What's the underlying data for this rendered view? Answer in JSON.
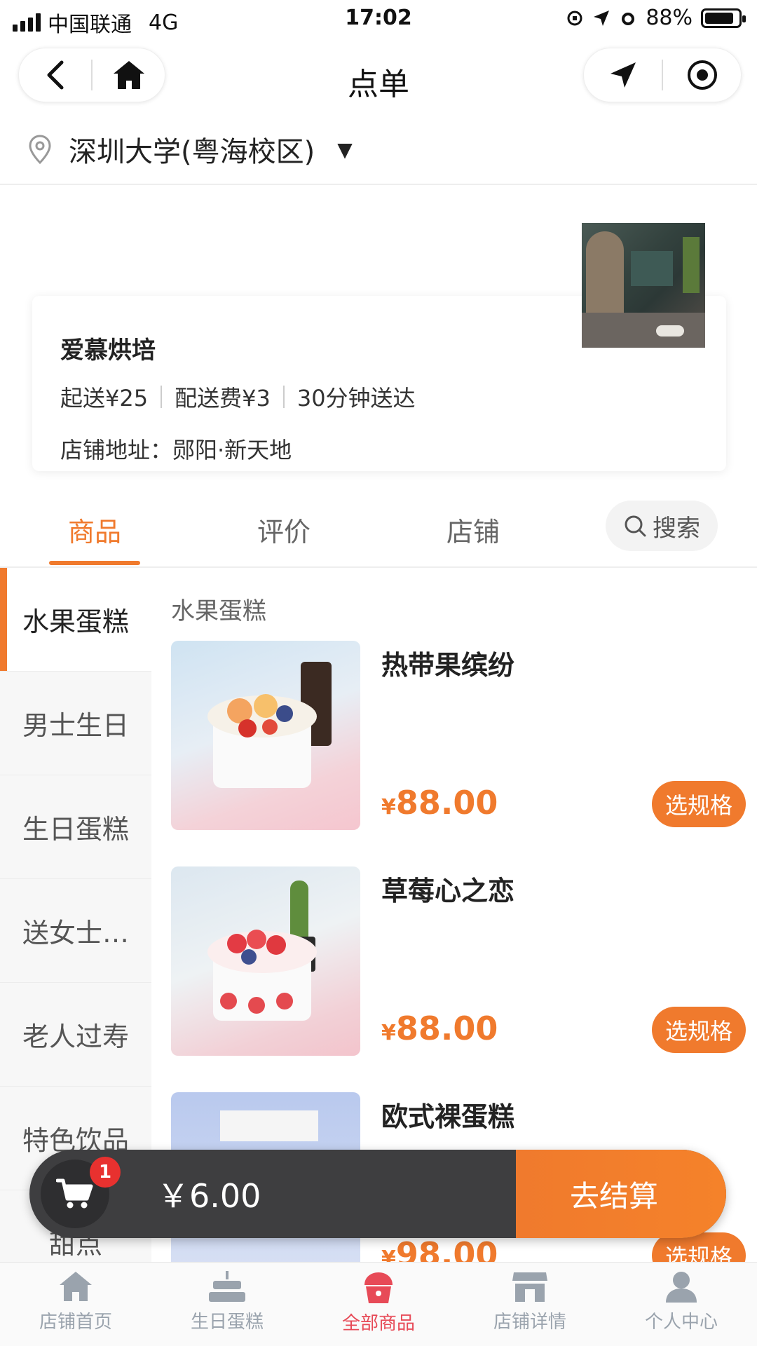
{
  "status_bar": {
    "carrier": "中国联通",
    "network": "4G",
    "time": "17:02",
    "battery_text": "88%",
    "battery_level": 0.88
  },
  "nav": {
    "title": "点单",
    "back_icon": "back-chevron-icon",
    "home_icon": "home-icon",
    "location_arrow_icon": "location-arrow-icon",
    "record_icon": "target-icon"
  },
  "location": {
    "name": "深圳大学(粤海校区)",
    "caret": "▼"
  },
  "store": {
    "name": "爱慕烘培",
    "min_order": "起送¥25",
    "delivery_fee": "配送费¥3",
    "delivery_time": "30分钟送达",
    "address": "店铺地址：郧阳·新天地"
  },
  "tabs": {
    "items": [
      {
        "label": "商品",
        "active": true
      },
      {
        "label": "评价",
        "active": false
      },
      {
        "label": "店铺",
        "active": false
      }
    ],
    "search_label": "搜索"
  },
  "sidebar": {
    "items": [
      {
        "label": "水果蛋糕",
        "active": true
      },
      {
        "label": "男士生日",
        "active": false
      },
      {
        "label": "生日蛋糕",
        "active": false
      },
      {
        "label": "送女士…",
        "active": false
      },
      {
        "label": "老人过寿",
        "active": false
      },
      {
        "label": "特色饮品",
        "active": false
      },
      {
        "label": "甜点",
        "active": false
      }
    ]
  },
  "products": {
    "category_title": "水果蛋糕",
    "items": [
      {
        "name": "热带果缤纷",
        "currency": "¥",
        "price": "88.00",
        "button": "选规格"
      },
      {
        "name": "草莓心之恋",
        "currency": "¥",
        "price": "88.00",
        "button": "选规格"
      },
      {
        "name": "欧式裸蛋糕",
        "currency": "¥",
        "price": "98.00",
        "button": "选规格"
      }
    ]
  },
  "cart": {
    "badge_count": "1",
    "total": "￥6.00",
    "checkout_label": "去结算"
  },
  "tabbar": {
    "items": [
      {
        "label": "店铺首页",
        "icon": "home-icon",
        "active": false
      },
      {
        "label": "生日蛋糕",
        "icon": "birthday-cake-icon",
        "active": false
      },
      {
        "label": "全部商品",
        "icon": "cupcake-icon",
        "active": true
      },
      {
        "label": "店铺详情",
        "icon": "storefront-icon",
        "active": false
      },
      {
        "label": "个人中心",
        "icon": "user-icon",
        "active": false
      }
    ]
  },
  "colors": {
    "accent": "#f07a2d",
    "cart_bar": "#3e3e40",
    "badge": "#e8312f",
    "tab_active": "#e74a57",
    "tab_inactive": "#9aa3ad"
  }
}
